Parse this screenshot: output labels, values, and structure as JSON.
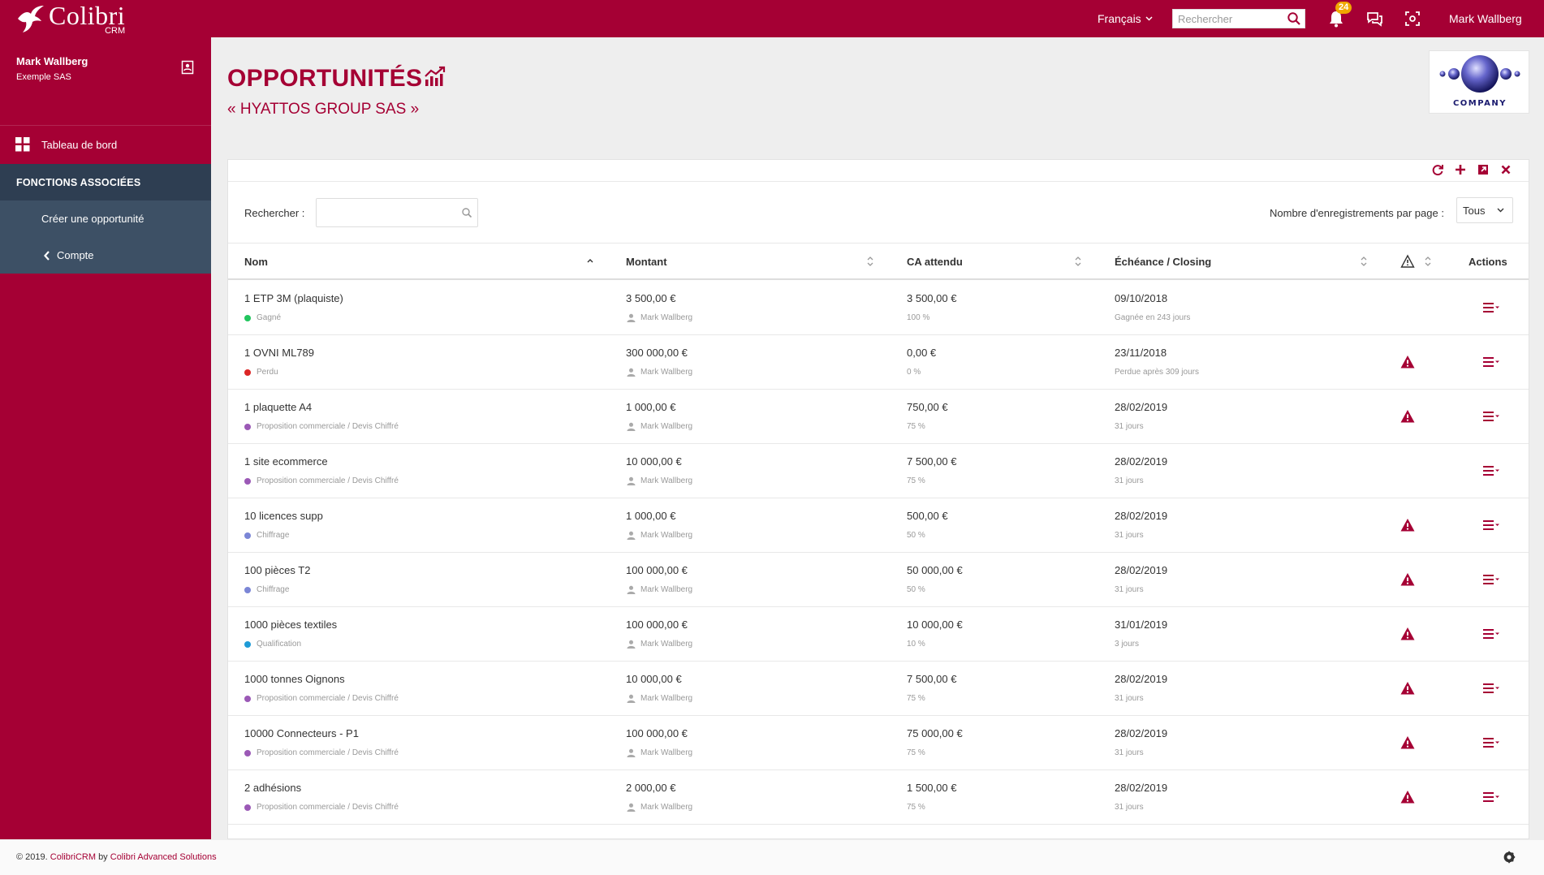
{
  "app": {
    "logo_name": "Colibri",
    "logo_sub": "CRM"
  },
  "topbar": {
    "language": "Français",
    "search_placeholder": "Rechercher",
    "notifications_count": "24",
    "user_name": "Mark Wallberg"
  },
  "sidebar": {
    "user_name": "Mark Wallberg",
    "user_company": "Exemple SAS",
    "dashboard_label": "Tableau de bord",
    "section_title": "FONCTIONS ASSOCIÉES",
    "items": [
      {
        "label": "Créer une opportunité"
      },
      {
        "label": "Compte",
        "icon": "chevron-left-icon"
      }
    ]
  },
  "header": {
    "title": "OPPORTUNITÉS",
    "subtitle": "« HYATTOS GROUP SAS »",
    "company_logo_text": "COMPANY"
  },
  "filters": {
    "search_label": "Rechercher :",
    "search_value": "",
    "per_page_label": "Nombre d'enregistrements par page :",
    "per_page_value": "Tous"
  },
  "table": {
    "columns": {
      "name": "Nom",
      "amount": "Montant",
      "expected": "CA attendu",
      "due": "Échéance / Closing",
      "actions": "Actions"
    },
    "rows": [
      {
        "name": "1 ETP 3M (plaquiste)",
        "stage": "Gagné",
        "stage_color": "#22c55e",
        "amount": "3 500,00 €",
        "owner": "Mark Wallberg",
        "expected": "3 500,00 €",
        "percent": "100 %",
        "date": "09/10/2018",
        "date_note": "Gagnée en 243 jours",
        "warning": false
      },
      {
        "name": "1 OVNI ML789",
        "stage": "Perdu",
        "stage_color": "#dc2626",
        "amount": "300 000,00 €",
        "owner": "Mark Wallberg",
        "expected": "0,00 €",
        "percent": "0 %",
        "date": "23/11/2018",
        "date_note": "Perdue après 309 jours",
        "warning": true
      },
      {
        "name": "1 plaquette A4",
        "stage": "Proposition commerciale / Devis Chiffré",
        "stage_color": "#9b59b6",
        "amount": "1 000,00 €",
        "owner": "Mark Wallberg",
        "expected": "750,00 €",
        "percent": "75 %",
        "date": "28/02/2019",
        "date_note": "31 jours",
        "warning": true
      },
      {
        "name": "1 site ecommerce",
        "stage": "Proposition commerciale / Devis Chiffré",
        "stage_color": "#9b59b6",
        "amount": "10 000,00 €",
        "owner": "Mark Wallberg",
        "expected": "7 500,00 €",
        "percent": "75 %",
        "date": "28/02/2019",
        "date_note": "31 jours",
        "warning": false
      },
      {
        "name": "10 licences supp",
        "stage": "Chiffrage",
        "stage_color": "#7b86d6",
        "amount": "1 000,00 €",
        "owner": "Mark Wallberg",
        "expected": "500,00 €",
        "percent": "50 %",
        "date": "28/02/2019",
        "date_note": "31 jours",
        "warning": true
      },
      {
        "name": "100 pièces T2",
        "stage": "Chiffrage",
        "stage_color": "#7b86d6",
        "amount": "100 000,00 €",
        "owner": "Mark Wallberg",
        "expected": "50 000,00 €",
        "percent": "50 %",
        "date": "28/02/2019",
        "date_note": "31 jours",
        "warning": true
      },
      {
        "name": "1000 pièces textiles",
        "stage": "Qualification",
        "stage_color": "#1e9bd7",
        "amount": "100 000,00 €",
        "owner": "Mark Wallberg",
        "expected": "10 000,00 €",
        "percent": "10 %",
        "date": "31/01/2019",
        "date_note": "3 jours",
        "warning": true
      },
      {
        "name": "1000 tonnes Oignons",
        "stage": "Proposition commerciale / Devis Chiffré",
        "stage_color": "#9b59b6",
        "amount": "10 000,00 €",
        "owner": "Mark Wallberg",
        "expected": "7 500,00 €",
        "percent": "75 %",
        "date": "28/02/2019",
        "date_note": "31 jours",
        "warning": true
      },
      {
        "name": "10000 Connecteurs - P1",
        "stage": "Proposition commerciale / Devis Chiffré",
        "stage_color": "#9b59b6",
        "amount": "100 000,00 €",
        "owner": "Mark Wallberg",
        "expected": "75 000,00 €",
        "percent": "75 %",
        "date": "28/02/2019",
        "date_note": "31 jours",
        "warning": true
      },
      {
        "name": "2 adhésions",
        "stage": "Proposition commerciale / Devis Chiffré",
        "stage_color": "#9b59b6",
        "amount": "2 000,00 €",
        "owner": "Mark Wallberg",
        "expected": "1 500,00 €",
        "percent": "75 %",
        "date": "28/02/2019",
        "date_note": "31 jours",
        "warning": true
      }
    ]
  },
  "footer": {
    "copyright": "© 2019.",
    "product": "ColibriCRM",
    "by": "by",
    "company": "Colibri Advanced Solutions"
  },
  "colors": {
    "brand": "#a50034",
    "section_bg": "#2e3e52",
    "item_bg": "#3d5065"
  }
}
